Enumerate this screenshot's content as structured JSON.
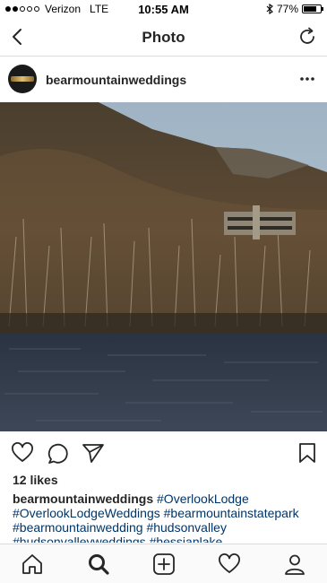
{
  "status_bar": {
    "carrier": "Verizon",
    "network": "LTE",
    "time": "10:55 AM",
    "battery": "77%",
    "battery_level": 0.77,
    "signal_bars_filled": 2,
    "signal_bars_total": 5
  },
  "nav": {
    "title": "Photo",
    "back_icon": "chevron-left-icon",
    "refresh_icon": "refresh-icon"
  },
  "post": {
    "username": "bearmountainweddings",
    "more_icon": "ellipsis-icon",
    "photo_icon": "landscape-photo",
    "likes": "12 likes",
    "caption": {
      "user": "bearmountainweddings",
      "tags": [
        "#OverlookLodge",
        "#OverlookLodgeWeddings",
        "#bearmountainstatepark",
        "#bearmountainwedding",
        "#hudsonvalley",
        "#hudsonvalleyweddings",
        "#hessianlake"
      ]
    }
  },
  "actions": {
    "like_icon": "heart-icon",
    "comment_icon": "comment-icon",
    "share_icon": "send-icon",
    "save_icon": "bookmark-icon"
  },
  "tab_bar": {
    "items": [
      "home-icon",
      "search-icon",
      "add-icon",
      "activity-icon",
      "profile-icon"
    ],
    "active": "search-icon"
  },
  "colors": {
    "text": "#262626",
    "hashtag": "#003569",
    "divider": "#dbdbdb",
    "tab_bar_bg": "#fafafa"
  }
}
